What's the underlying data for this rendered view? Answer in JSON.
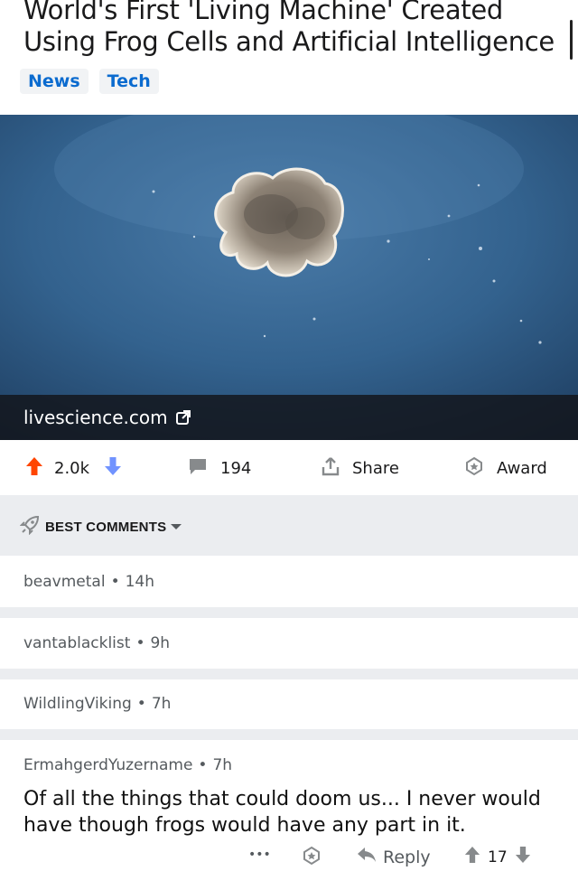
{
  "post": {
    "title": "World's First 'Living Machine' Created Using Frog Cells and Artificial Intelligence",
    "tags": [
      "News",
      "Tech"
    ],
    "link_domain": "livescience.com"
  },
  "actions": {
    "upvotes": "2.0k",
    "comments": "194",
    "share": "Share",
    "award": "Award"
  },
  "comments_header": "BEST COMMENTS",
  "comments": [
    {
      "author": "beavmetal",
      "age": "14h"
    },
    {
      "author": "vantablacklist",
      "age": "9h"
    },
    {
      "author": "WildlingViking",
      "age": "7h"
    },
    {
      "author": "ErmahgerdYuzername",
      "age": "7h",
      "body": "Of all the things that could doom us... I never would have though frogs would have any part in it."
    }
  ],
  "comment_actions": {
    "more": "•••",
    "reply": "Reply",
    "score": "17"
  },
  "colors": {
    "upvote": "#ff4500",
    "downvote": "#7193ff",
    "tag_text": "#0b6bcf",
    "band": "#ebedf0"
  }
}
